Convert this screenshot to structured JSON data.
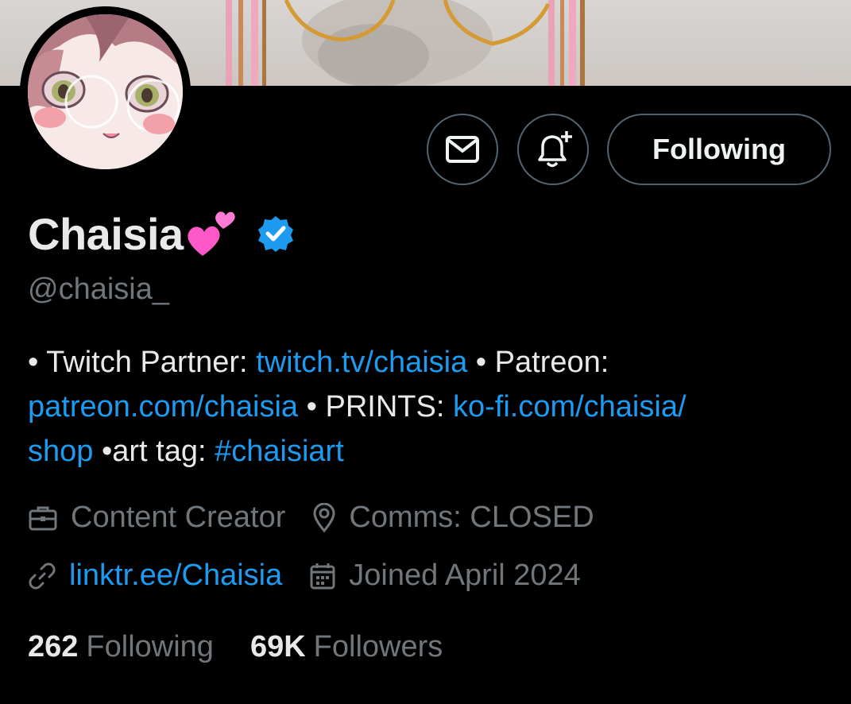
{
  "profile": {
    "display_name": "Chaisia",
    "name_emoji": "two-hearts-emoji",
    "verified": true,
    "handle": "@chaisia_",
    "bio": {
      "p1": "• Twitch Partner: ",
      "twitch_link": "twitch.tv/chaisia",
      "p2": " • Patreon: ",
      "patreon_link": "patreon.com/chaisia",
      "p3": " • PRINTS: ",
      "prints_link": "ko-fi.com/chaisia/shop",
      "p4": " •art tag: ",
      "hashtag": "#chaisiart"
    },
    "category": "Content Creator",
    "location": "Comms: CLOSED",
    "website": "linktr.ee/Chaisia",
    "joined": "Joined April 2024",
    "following_count": "262",
    "following_label": "Following",
    "followers_count": "69K",
    "followers_label": "Followers"
  },
  "actions": {
    "message_icon": "envelope-icon",
    "notify_icon": "bell-plus-icon",
    "follow_label": "Following"
  },
  "colors": {
    "background": "#000000",
    "text": "#e7e9ea",
    "secondary": "#71767b",
    "link": "#1d9bf0",
    "border": "#536471",
    "verified": "#1d9bf0"
  }
}
